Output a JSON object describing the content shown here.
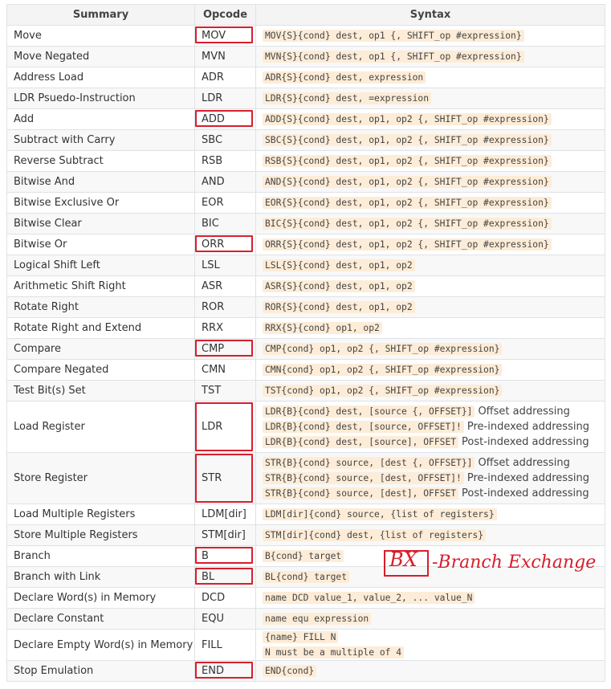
{
  "headers": [
    "Summary",
    "Opcode",
    "Syntax"
  ],
  "rows": [
    {
      "summary": "Move",
      "opcode": "MOV",
      "syntax": [
        "MOV{S}{cond} dest, op1 {, SHIFT_op #expression}"
      ],
      "highlight": true
    },
    {
      "summary": "Move Negated",
      "opcode": "MVN",
      "syntax": [
        "MVN{S}{cond} dest, op1 {, SHIFT_op #expression}"
      ]
    },
    {
      "summary": "Address Load",
      "opcode": "ADR",
      "syntax": [
        "ADR{S}{cond} dest, expression"
      ]
    },
    {
      "summary": "LDR Psuedo-Instruction",
      "opcode": "LDR",
      "syntax": [
        "LDR{S}{cond} dest, =expression"
      ]
    },
    {
      "summary": "Add",
      "opcode": "ADD",
      "syntax": [
        "ADD{S}{cond} dest, op1, op2 {, SHIFT_op #expression}"
      ],
      "highlight": true
    },
    {
      "summary": "Subtract with Carry",
      "opcode": "SBC",
      "syntax": [
        "SBC{S}{cond} dest, op1, op2 {, SHIFT_op #expression}"
      ]
    },
    {
      "summary": "Reverse Subtract",
      "opcode": "RSB",
      "syntax": [
        "RSB{S}{cond} dest, op1, op2 {, SHIFT_op #expression}"
      ]
    },
    {
      "summary": "Bitwise And",
      "opcode": "AND",
      "syntax": [
        "AND{S}{cond} dest, op1, op2 {, SHIFT_op #expression}"
      ]
    },
    {
      "summary": "Bitwise Exclusive Or",
      "opcode": "EOR",
      "syntax": [
        "EOR{S}{cond} dest, op1, op2 {, SHIFT_op #expression}"
      ]
    },
    {
      "summary": "Bitwise Clear",
      "opcode": "BIC",
      "syntax": [
        "BIC{S}{cond} dest, op1, op2 {, SHIFT_op #expression}"
      ]
    },
    {
      "summary": "Bitwise Or",
      "opcode": "ORR",
      "syntax": [
        "ORR{S}{cond} dest, op1, op2 {, SHIFT_op #expression}"
      ],
      "highlight": true
    },
    {
      "summary": "Logical Shift Left",
      "opcode": "LSL",
      "syntax": [
        "LSL{S}{cond} dest, op1, op2"
      ]
    },
    {
      "summary": "Arithmetic Shift Right",
      "opcode": "ASR",
      "syntax": [
        "ASR{S}{cond} dest, op1, op2"
      ]
    },
    {
      "summary": "Rotate Right",
      "opcode": "ROR",
      "syntax": [
        "ROR{S}{cond} dest, op1, op2"
      ]
    },
    {
      "summary": "Rotate Right and Extend",
      "opcode": "RRX",
      "syntax": [
        "RRX{S}{cond} op1, op2"
      ]
    },
    {
      "summary": "Compare",
      "opcode": "CMP",
      "syntax": [
        "CMP{cond} op1, op2 {, SHIFT_op #expression}"
      ],
      "highlight": true
    },
    {
      "summary": "Compare Negated",
      "opcode": "CMN",
      "syntax": [
        "CMN{cond} op1, op2 {, SHIFT_op #expression}"
      ]
    },
    {
      "summary": "Test Bit(s) Set",
      "opcode": "TST",
      "syntax": [
        "TST{cond} op1, op2 {, SHIFT_op #expression}"
      ]
    },
    {
      "summary": "Load Register",
      "opcode": "LDR",
      "tall": true,
      "highlight": true,
      "syntax": [
        "LDR{B}{cond} dest, [source {, OFFSET}]",
        "LDR{B}{cond} dest, [source, OFFSET]!",
        "LDR{B}{cond} dest, [source], OFFSET"
      ],
      "desc": [
        "Offset addressing",
        "Pre-indexed addressing",
        "Post-indexed addressing"
      ]
    },
    {
      "summary": "Store Register",
      "opcode": "STR",
      "tall": true,
      "highlight": true,
      "syntax": [
        "STR{B}{cond} source, [dest {, OFFSET}]",
        "STR{B}{cond} source, [dest, OFFSET]!",
        "STR{B}{cond} source, [dest], OFFSET"
      ],
      "desc": [
        "Offset addressing",
        "Pre-indexed addressing",
        "Post-indexed addressing"
      ]
    },
    {
      "summary": "Load Multiple Registers",
      "opcode": "LDM[dir]",
      "syntax": [
        "LDM[dir]{cond} source, {list of registers}"
      ]
    },
    {
      "summary": "Store Multiple Registers",
      "opcode": "STM[dir]",
      "syntax": [
        "STM[dir]{cond} dest, {list of registers}"
      ]
    },
    {
      "summary": "Branch",
      "opcode": "B",
      "syntax": [
        "B{cond} target"
      ],
      "highlight": true
    },
    {
      "summary": "Branch with Link",
      "opcode": "BL",
      "syntax": [
        "BL{cond} target"
      ],
      "highlight": true
    },
    {
      "summary": "Declare Word(s) in Memory",
      "opcode": "DCD",
      "syntax": [
        "name DCD value_1, value_2, ... value_N"
      ]
    },
    {
      "summary": "Declare Constant",
      "opcode": "EQU",
      "syntax": [
        "name equ expression"
      ]
    },
    {
      "summary": "Declare Empty Word(s) in Memory",
      "opcode": "FILL",
      "mid": true,
      "syntax": [
        "{name} FILL N",
        "N must be a multiple of 4"
      ]
    },
    {
      "summary": "Stop Emulation",
      "opcode": "END",
      "syntax": [
        "END{cond}"
      ],
      "highlight": true
    }
  ],
  "annotation": {
    "boxed": "BX",
    "text": "-Branch Exchange"
  },
  "colors": {
    "highlight": "#d81e2c",
    "code_bg": "#fdecd7"
  }
}
